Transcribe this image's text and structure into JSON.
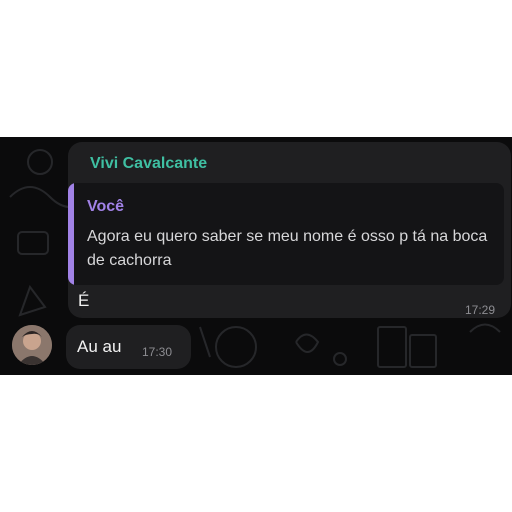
{
  "messages": [
    {
      "sender": "Vivi Cavalcante",
      "reply": {
        "author": "Você",
        "text": "Agora eu quero saber se meu nome é osso p tá na boca de cachorra"
      },
      "text": "É",
      "time": "17:29"
    },
    {
      "text": "Au au",
      "time": "17:30"
    }
  ],
  "colors": {
    "background": "#0b0b0c",
    "bubble": "#1f1f21",
    "sender_name": "#3fbfa2",
    "quote_accent": "#a182e6",
    "timestamp": "#8d8d92"
  }
}
